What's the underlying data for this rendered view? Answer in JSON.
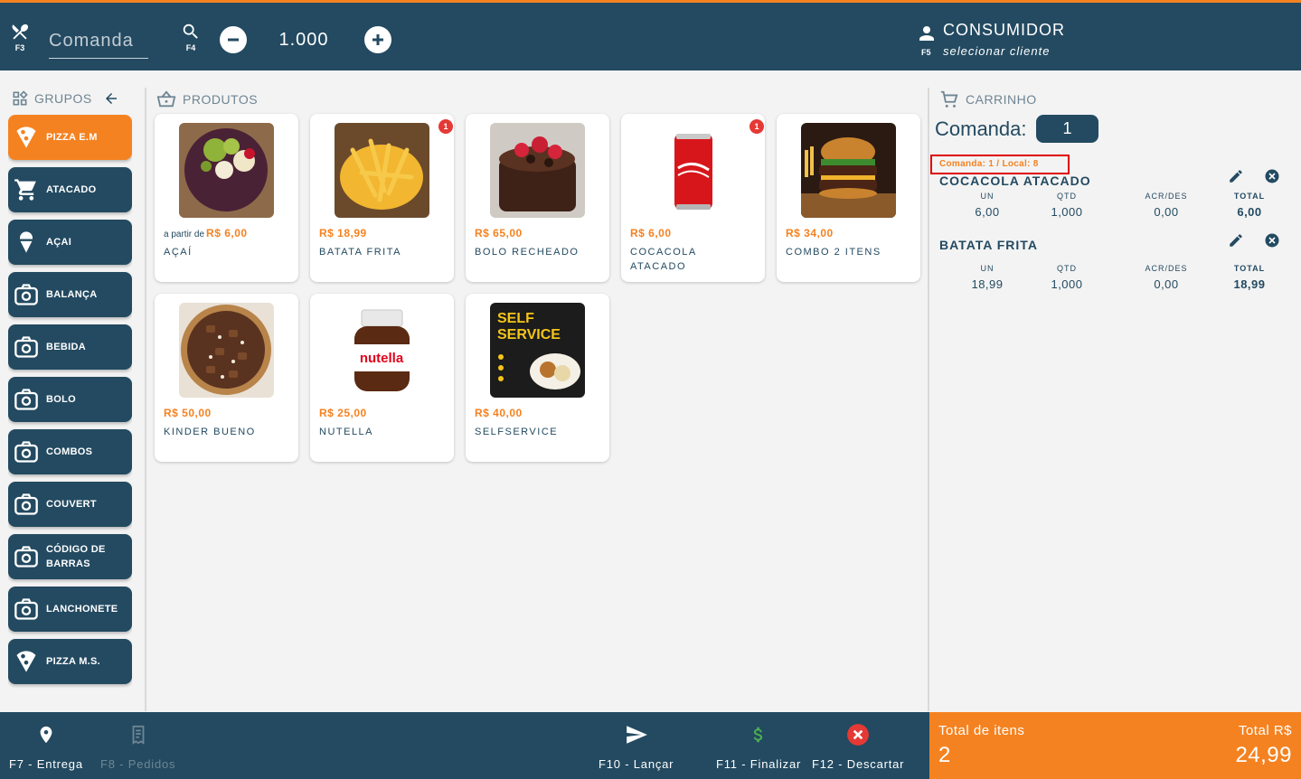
{
  "header": {
    "comanda_fkey": "F3",
    "search_fkey": "F4",
    "comanda_placeholder": "Comanda",
    "quantity": "1.000",
    "client_fkey": "F5",
    "client_name": "CONSUMIDOR",
    "client_action": "selecionar cliente"
  },
  "groups": {
    "title": "GRUPOS",
    "items": [
      {
        "label": "PIZZA E.M",
        "icon": "pizza-icon",
        "active": true
      },
      {
        "label": "ATACADO",
        "icon": "cart-icon"
      },
      {
        "label": "AÇAI",
        "icon": "ice-cream-icon"
      },
      {
        "label": "BALANÇA",
        "icon": "camera-icon"
      },
      {
        "label": "BEBIDA",
        "icon": "camera-icon"
      },
      {
        "label": "BOLO",
        "icon": "camera-icon"
      },
      {
        "label": "COMBOS",
        "icon": "camera-icon"
      },
      {
        "label": "COUVERT",
        "icon": "camera-icon"
      },
      {
        "label": "CÓDIGO DE BARRAS",
        "icon": "camera-icon"
      },
      {
        "label": "LANCHONETE",
        "icon": "camera-icon"
      },
      {
        "label": "PIZZA M.S.",
        "icon": "pizza-icon"
      }
    ]
  },
  "products": {
    "title": "PRODUTOS",
    "items": [
      {
        "prefix": "a partir de",
        "price": "R$ 6,00",
        "name": "AÇAÍ",
        "badge": ""
      },
      {
        "prefix": "",
        "price": "R$ 18,99",
        "name": "BATATA FRITA",
        "badge": "1"
      },
      {
        "prefix": "",
        "price": "R$ 65,00",
        "name": "BOLO RECHEADO",
        "badge": ""
      },
      {
        "prefix": "",
        "price": "R$ 6,00",
        "name": "COCACOLA ATACADO",
        "badge": "1"
      },
      {
        "prefix": "",
        "price": "R$ 34,00",
        "name": "COMBO 2 ITENS",
        "badge": ""
      },
      {
        "prefix": "",
        "price": "R$ 50,00",
        "name": "KINDER BUENO",
        "badge": ""
      },
      {
        "prefix": "",
        "price": "R$ 25,00",
        "name": "NUTELLA",
        "badge": ""
      },
      {
        "prefix": "",
        "price": "R$ 40,00",
        "name": "SELFSERVICE",
        "badge": ""
      }
    ]
  },
  "cart": {
    "title": "CARRINHO",
    "comanda_label": "Comanda:",
    "comanda_number": "1",
    "local_tag": "Comanda: 1 / Local: 8",
    "col_un": "UN",
    "col_qtd": "QTD",
    "col_acr": "ACR/DES",
    "col_total": "TOTAL",
    "items": [
      {
        "name": "COCACOLA ATACADO",
        "un": "6,00",
        "qtd": "1,000",
        "acr": "0,00",
        "total": "6,00"
      },
      {
        "name": "BATATA FRITA",
        "un": "18,99",
        "qtd": "1,000",
        "acr": "0,00",
        "total": "18,99"
      }
    ]
  },
  "footer": {
    "delivery": "F7 - Entrega",
    "orders": "F8 - Pedidos",
    "launch": "F10 - Lançar",
    "finish": "F11 - Finalizar",
    "discard": "F12 - Descartar",
    "total_items_label": "Total de itens",
    "total_items": "2",
    "total_label": "Total R$",
    "total_value": "24,99"
  },
  "colors": {
    "primary": "#234a61",
    "accent": "#f58220",
    "danger": "#e53935",
    "finish": "#4caf50"
  }
}
